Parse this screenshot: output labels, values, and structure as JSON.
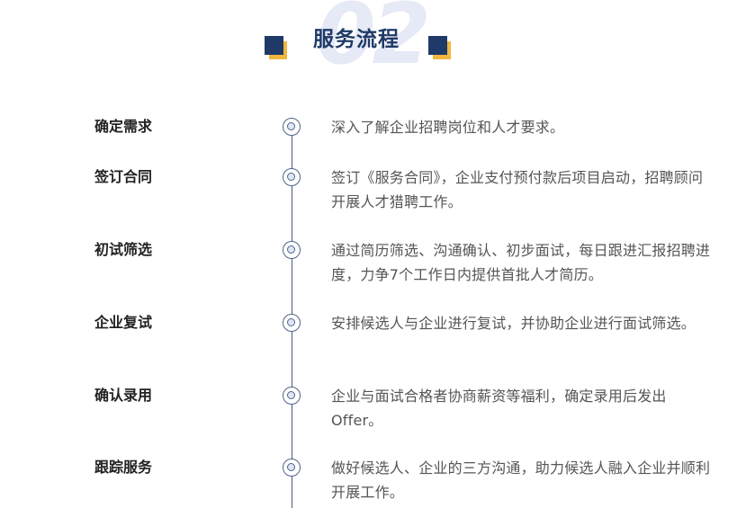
{
  "header": {
    "number": "02",
    "title": "服务流程"
  },
  "steps": [
    {
      "label": "确定需求",
      "desc": "深入了解企业招聘岗位和人才要求。"
    },
    {
      "label": "签订合同",
      "desc": "签订《服务合同》，企业支付预付款后项目启动，招聘顾问开展人才猎聘工作。"
    },
    {
      "label": "初试筛选",
      "desc": "通过简历筛选、沟通确认、初步面试，每日跟进汇报招聘进度，力争7个工作日内提供首批人才简历。"
    },
    {
      "label": "企业复试",
      "desc": "安排候选人与企业进行复试，并协助企业进行面试筛选。"
    },
    {
      "label": "确认录用",
      "desc": "企业与面试合格者协商薪资等福利，确定录用后发出Offer。"
    },
    {
      "label": "跟踪服务",
      "desc": "做好候选人、企业的三方沟通，助力候选人融入企业并顺利开展工作。"
    }
  ]
}
